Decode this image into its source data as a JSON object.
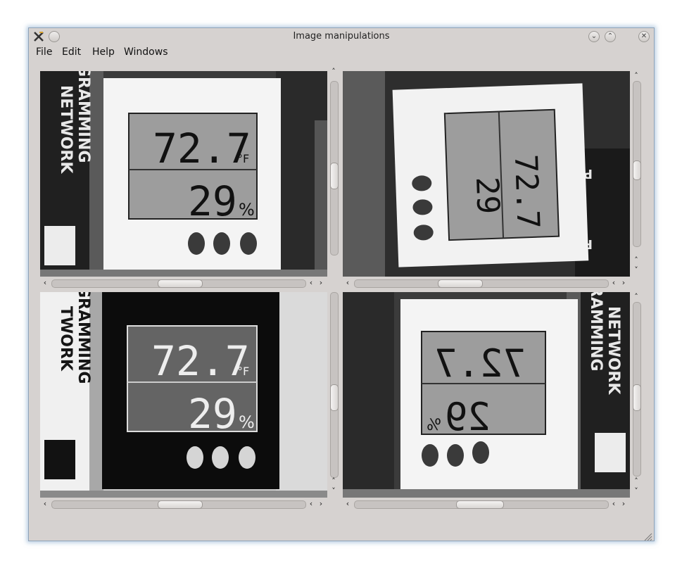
{
  "window": {
    "title": "Image manipulations",
    "controls": {
      "app_icon": "x-logo-icon",
      "pin": "pin-icon",
      "minimize": "minimize-icon",
      "maximize": "maximize-icon",
      "close": "close-icon"
    }
  },
  "menubar": {
    "items": [
      {
        "label": "File"
      },
      {
        "label": "Edit"
      },
      {
        "label": "Help"
      },
      {
        "label": "Windows"
      }
    ]
  },
  "panes": [
    {
      "name": "original",
      "display_temp": "72.7",
      "display_unit": "°F",
      "display_humidity": "29",
      "humidity_unit": "%",
      "transform": "none"
    },
    {
      "name": "rotated",
      "display_temp": "72.7",
      "display_unit": "°F",
      "display_humidity": "29",
      "humidity_unit": "%",
      "transform": "rotate"
    },
    {
      "name": "inverted",
      "display_temp": "72.7",
      "display_unit": "°F",
      "display_humidity": "29",
      "humidity_unit": "%",
      "transform": "invert"
    },
    {
      "name": "flipped",
      "display_temp": "72.7",
      "display_unit": "°F",
      "display_humidity": "29",
      "humidity_unit": "%",
      "transform": "flip"
    }
  ],
  "scrollbars": {
    "arrow_left": "‹",
    "arrow_right": "›",
    "arrow_up": "˄",
    "arrow_down": "˅"
  },
  "colors": {
    "window_bg": "#d6d2d0",
    "window_border": "#8fa3b8",
    "image_dark": "#1a1a1a",
    "image_light": "#f2f2f2",
    "lcd": "#9a9a9a"
  }
}
